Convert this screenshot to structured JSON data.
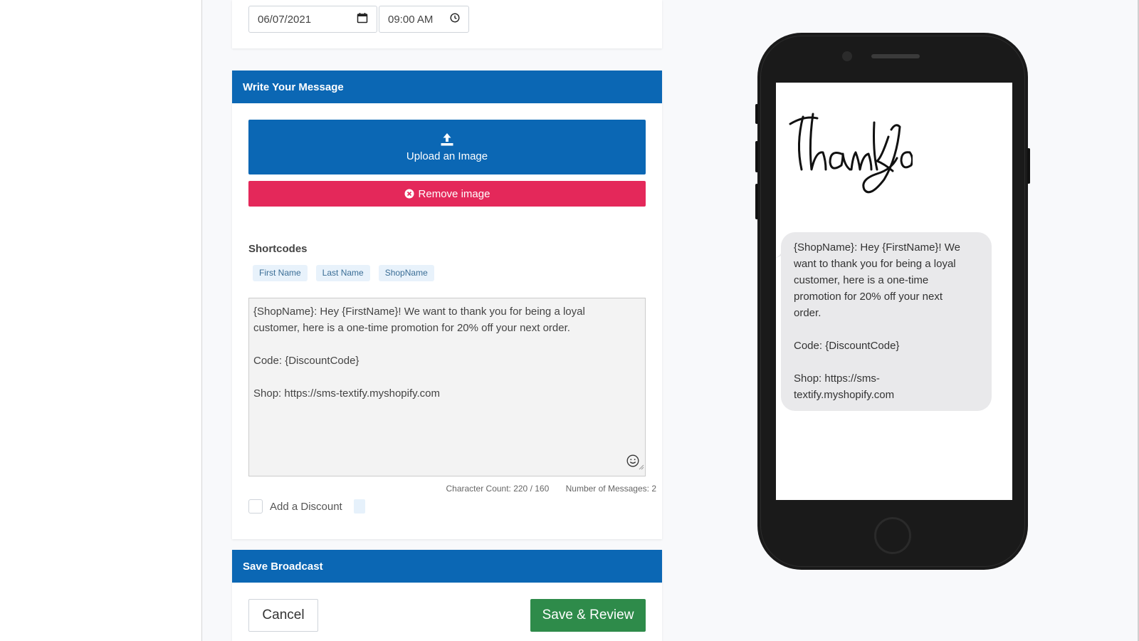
{
  "schedule": {
    "date_value": "06/07/2021",
    "time_value": "09:00 AM"
  },
  "message_section": {
    "header": "Write Your Message",
    "upload_label": "Upload an Image",
    "remove_label": "Remove image",
    "shortcodes_title": "Shortcodes",
    "shortcodes": [
      "First Name",
      "Last Name",
      "ShopName"
    ],
    "message_lines": [
      "{ShopName}: Hey {FirstName}! We want to thank you for being a loyal",
      "customer, here is a one-time promotion for 20% off your next order.",
      "",
      "Code: {DiscountCode}",
      "",
      "Shop: https://sms-textify.myshopify.com"
    ],
    "character_count": "Character Count: 220 / 160",
    "number_of_messages": "Number of Messages: 2",
    "add_discount_label": "Add a Discount",
    "add_discount_checked": false
  },
  "save_section": {
    "header": "Save Broadcast",
    "cancel_label": "Cancel",
    "save_label": "Save & Review"
  },
  "preview": {
    "image_text": "thank you",
    "bubble_lines": [
      "{ShopName}: Hey {FirstName}! We",
      "want to thank you for being a loyal",
      "customer, here is a one-time",
      "promotion for 20% off your next",
      "order.",
      "",
      "Code: {DiscountCode}",
      "",
      "Shop: https://sms-",
      "textify.myshopify.com"
    ]
  },
  "colors": {
    "primary": "#0b67b4",
    "danger": "#e4285a",
    "success": "#2e8b4a",
    "chip_bg": "#e8f2fb"
  },
  "icons": [
    "calendar-icon",
    "clock-icon",
    "upload-icon",
    "remove-circle-icon",
    "emoji-icon"
  ]
}
